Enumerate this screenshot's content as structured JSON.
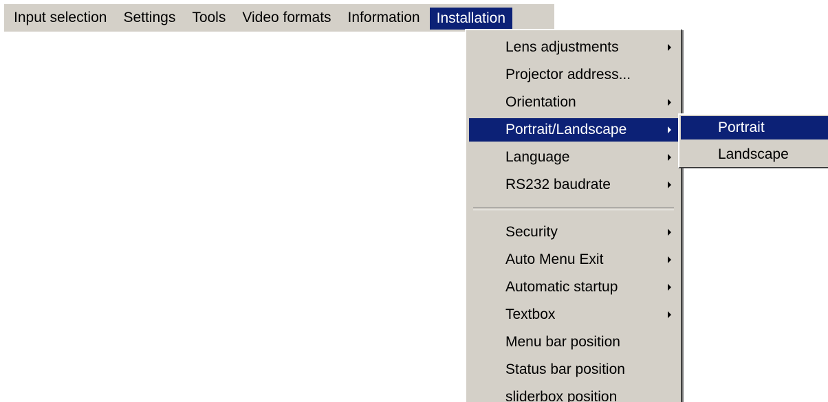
{
  "menubar": {
    "items": [
      {
        "label": "Input selection"
      },
      {
        "label": "Settings"
      },
      {
        "label": "Tools"
      },
      {
        "label": "Video formats"
      },
      {
        "label": "Information"
      },
      {
        "label": "Installation",
        "active": true
      }
    ]
  },
  "installation_menu": {
    "items": [
      {
        "label": "Lens adjustments",
        "submenu": true
      },
      {
        "label": "Projector address...",
        "submenu": false
      },
      {
        "label": "Orientation",
        "submenu": true
      },
      {
        "label": "Portrait/Landscape",
        "submenu": true,
        "highlighted": true
      },
      {
        "label": "Language",
        "submenu": true
      },
      {
        "label": "RS232 baudrate",
        "submenu": true
      },
      {
        "label": "Security",
        "submenu": true
      },
      {
        "label": "Auto Menu Exit",
        "submenu": true
      },
      {
        "label": "Automatic startup",
        "submenu": true
      },
      {
        "label": "Textbox",
        "submenu": true
      },
      {
        "label": "Menu bar position",
        "submenu": false
      },
      {
        "label": "Status bar position",
        "submenu": false
      },
      {
        "label": "sliderbox position",
        "submenu": false
      }
    ]
  },
  "orientation_submenu": {
    "items": [
      {
        "label": "Portrait",
        "highlighted": true
      },
      {
        "label": "Landscape"
      }
    ]
  },
  "colors": {
    "menu_background": "#d4d0c8",
    "highlight": "#0c2176",
    "highlight_text": "#ffffff"
  },
  "icons": {
    "submenu_arrow": "triangle-right-icon"
  }
}
